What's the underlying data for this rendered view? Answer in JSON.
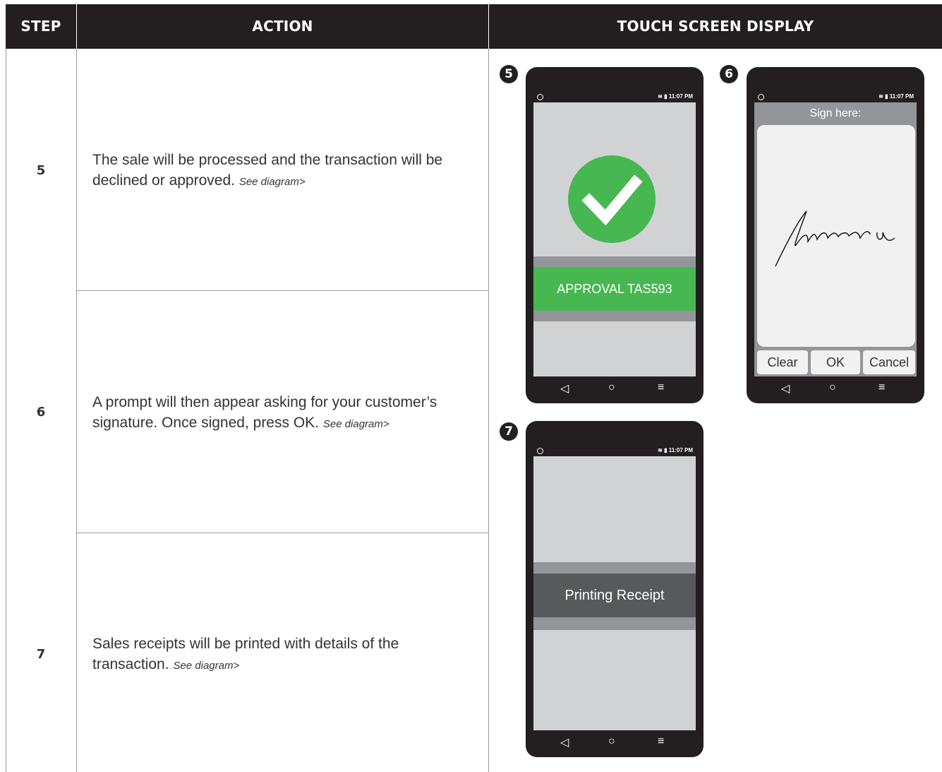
{
  "table": {
    "headers": {
      "step": "STEP",
      "action": "ACTION",
      "display": "TOUCH SCREEN DISPLAY"
    },
    "rows": [
      {
        "step": "5",
        "text": "The sale will be processed and the transaction will be declined or approved. ",
        "see": "See diagram>"
      },
      {
        "step": "6",
        "text": "A prompt will then appear asking for your customer’s signature. Once signed, press OK. ",
        "see": "See diagram>"
      },
      {
        "step": "7",
        "text": "Sales receipts will be printed with details of the transaction. ",
        "see": "See diagram>"
      }
    ]
  },
  "status_bar": {
    "time": "11:07 PM"
  },
  "screens": {
    "s5": {
      "badge": "5",
      "approval_text": "APPROVAL TAS593",
      "accent_color": "#47b751"
    },
    "s6": {
      "badge": "6",
      "title": "Sign here:",
      "buttons": [
        "Clear",
        "OK",
        "Cancel"
      ]
    },
    "s7": {
      "badge": "7",
      "message": "Printing Receipt"
    }
  },
  "icons": {
    "nav": [
      "back-triangle-icon",
      "home-circle-icon",
      "menu-lines-icon"
    ],
    "status": [
      "clock-icon",
      "wifi-icon",
      "battery-icon"
    ]
  }
}
